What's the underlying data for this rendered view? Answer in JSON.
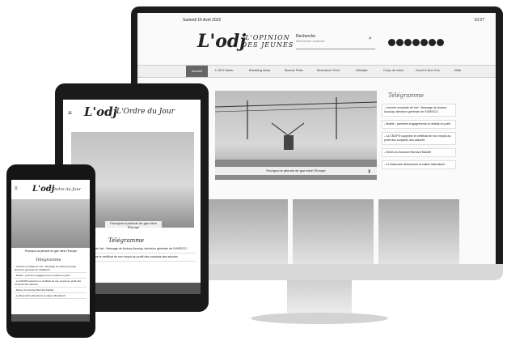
{
  "desktop": {
    "date": "Samedi 16 Avril 2022",
    "time": "10:27",
    "logo": "L'odj",
    "tagline": "L'OPINION DES JEUNES",
    "search": {
      "placeholder": "Recherche",
      "sub": "Recherche avancée"
    },
    "nav": [
      "Accueil",
      "L'ODJ Radio",
      "Breaking news",
      "Bourse Pass",
      "Mouvance Tech",
      "Lifestyle",
      "Coup de cœur",
      "Good & Bon Zon",
      "Web"
    ],
    "hero_caption": "Pourquoi la pénurie de gaz mine l'Europe",
    "telegram_title": "Télégramme",
    "telegram": [
      "- Journée mondiale de l'art : Message de Audrey Azoulay, directrice générale de l'UNESCO",
      "- Mobile : premiers engagements et retraits un point",
      "- La CNOPS supprime le certificat de non emploi au profit des conjoints des assurés",
      "- Décès du financier Bernard Madoff",
      "- Le Basenach abandonne la saison Marrakech"
    ]
  },
  "tablet": {
    "logo": "L'odj",
    "tagline": "L'Ordre du Jour",
    "hero_caption": "Pourquoi la pénurie de gaz mine l'Europe",
    "telegram_title": "Télégramme",
    "telegram": [
      "- Journée mondiale de l'art : Message de Audrey Azoulay, directrice générale de l'UNESCO",
      "- La CNOPS supprime le certificat de non emploi au profit des conjoints des assurés"
    ]
  },
  "phone": {
    "logo": "L'odj",
    "tagline": "L'Ordre du Jour",
    "hero_caption": "Pourquoi la pénurie de gaz mine l'Europe",
    "telegram_title": "Télégramme",
    "telegram": [
      "- Journée mondiale de l'art : Message de Audrey Azoulay, directrice générale de l'UNESCO",
      "- Mobile : premiers engagements et retraits un point",
      "- La CNOPS supprime le certificat de non emploi au profit des conjoints des assurés",
      "- Décès du financier Bernard Madoff",
      "- Le Basenach abandonne la saison Marrakech"
    ]
  }
}
